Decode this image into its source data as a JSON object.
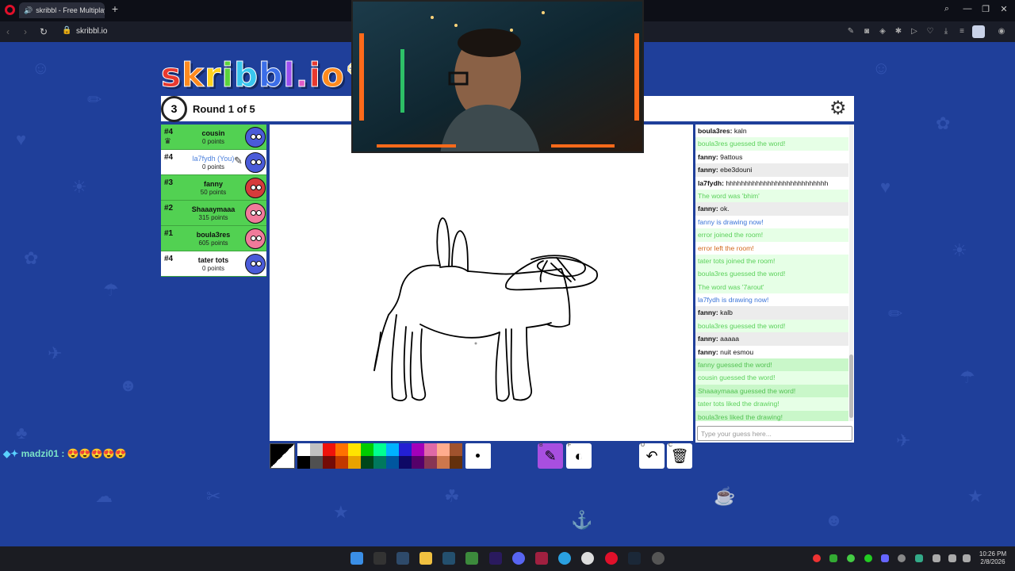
{
  "browser": {
    "tab_title": "skribbl - Free Multiplayer Drawing & Guessing Game",
    "url": "skribbl.io"
  },
  "game": {
    "logo": "skribbl.io",
    "round_label": "Round 1 of 5",
    "timer": "3"
  },
  "players": [
    {
      "rank": "#4",
      "name": "cousin",
      "points": "0 points",
      "avatar_color": "#4a5bd9",
      "green": true,
      "crown": true
    },
    {
      "rank": "#4",
      "name": "la7fydh (You)",
      "points": "0 points",
      "avatar_color": "#4a5bd9",
      "green": false,
      "you": true,
      "drawing": true
    },
    {
      "rank": "#3",
      "name": "fanny",
      "points": "50 points",
      "avatar_color": "#d63b3b",
      "green": true
    },
    {
      "rank": "#2",
      "name": "Shaaaymaaa",
      "points": "315 points",
      "avatar_color": "#f07a9a",
      "green": true
    },
    {
      "rank": "#1",
      "name": "boula3res",
      "points": "605 points",
      "avatar_color": "#f07a9a",
      "green": true
    },
    {
      "rank": "#4",
      "name": "tater tots",
      "points": "0 points",
      "avatar_color": "#4a5bd9",
      "green": false
    }
  ],
  "chat": [
    {
      "user": "boula3res:",
      "text": "kaln",
      "style": "normal"
    },
    {
      "user": "",
      "text": "boula3res guessed the word!",
      "style": "g"
    },
    {
      "user": "fanny:",
      "text": "9attous",
      "style": "normal"
    },
    {
      "user": "fanny:",
      "text": "ebe3douni",
      "style": "alt"
    },
    {
      "user": "la7fydh:",
      "text": "hhhhhhhhhhhhhhhhhhhhhhhhhhh",
      "style": "normal"
    },
    {
      "user": "",
      "text": "The word was 'bhim'",
      "style": "g"
    },
    {
      "user": "fanny:",
      "text": "ok.",
      "style": "alt"
    },
    {
      "user": "",
      "text": "fanny is drawing now!",
      "style": "b"
    },
    {
      "user": "",
      "text": "error joined the room!",
      "style": "g"
    },
    {
      "user": "",
      "text": "error left the room!",
      "style": "o"
    },
    {
      "user": "",
      "text": "tater tots joined the room!",
      "style": "g"
    },
    {
      "user": "",
      "text": "boula3res guessed the word!",
      "style": "g"
    },
    {
      "user": "",
      "text": "The word was '7arout'",
      "style": "g"
    },
    {
      "user": "",
      "text": "la7fydh is drawing now!",
      "style": "b"
    },
    {
      "user": "fanny:",
      "text": "kalb",
      "style": "alt"
    },
    {
      "user": "",
      "text": "boula3res guessed the word!",
      "style": "g"
    },
    {
      "user": "fanny:",
      "text": "aaaaa",
      "style": "alt"
    },
    {
      "user": "fanny:",
      "text": "nuit esmou",
      "style": "normal"
    },
    {
      "user": "",
      "text": "fanny guessed the word!",
      "style": "gg"
    },
    {
      "user": "",
      "text": "cousin guessed the word!",
      "style": "g"
    },
    {
      "user": "",
      "text": "Shaaaymaaa guessed the word!",
      "style": "gg"
    },
    {
      "user": "",
      "text": "tater tots liked the drawing!",
      "style": "g"
    },
    {
      "user": "",
      "text": "boula3res liked the drawing!",
      "style": "gg"
    }
  ],
  "guess_placeholder": "Type your guess here...",
  "palette": [
    "#ffffff",
    "#c1c1c1",
    "#ef130b",
    "#ff7100",
    "#ffe400",
    "#00cc00",
    "#00ff91",
    "#00b2ff",
    "#231fd3",
    "#a300ba",
    "#df69a7",
    "#ffac8e",
    "#a0522d",
    "#000000",
    "#505050",
    "#740b07",
    "#c23800",
    "#e8a200",
    "#004619",
    "#00785d",
    "#00569e",
    "#0e0865",
    "#550069",
    "#873554",
    "#cc774d",
    "#63300d"
  ],
  "tools": {
    "brush_key": "B",
    "fill_key": "F",
    "undo_key": "U",
    "clear_key": "C"
  },
  "overlay_chat": {
    "user": "madzi01",
    "separator": ":",
    "emotes": "😍😍😍😍😍"
  },
  "taskbar": {
    "time": "10:26 PM",
    "date": "2/8/2026"
  }
}
